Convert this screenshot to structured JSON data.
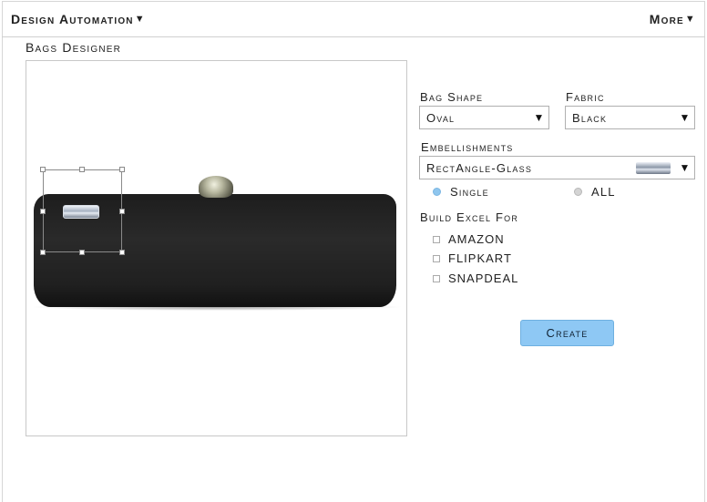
{
  "header": {
    "design_menu": "Design Automation",
    "more_menu": "More",
    "caret": "▼"
  },
  "section_title": "Bags Designer",
  "form": {
    "bag_shape": {
      "label": "Bag Shape",
      "value": "Oval"
    },
    "fabric": {
      "label": "Fabric",
      "value": "Black"
    },
    "embellishments": {
      "label": "Embellishments",
      "value": "RectAngle-Glass"
    },
    "apply_mode": [
      {
        "label": "Single",
        "selected": true
      },
      {
        "label": "ALL",
        "selected": false
      }
    ],
    "build_excel": {
      "label": "Build Excel For",
      "options": [
        {
          "label": "AMAZON",
          "checked": false
        },
        {
          "label": "FLIPKART",
          "checked": false
        },
        {
          "label": "SNAPDEAL",
          "checked": false
        }
      ]
    },
    "create_label": "Create"
  },
  "icons": {
    "dropdown": "caret-down-icon",
    "embellishment_preview": "glass-rectangle-icon"
  },
  "colors": {
    "accent": "#8ec8f4",
    "radio_selected": "#8fc6ee",
    "bag": "#1f1f1f"
  }
}
